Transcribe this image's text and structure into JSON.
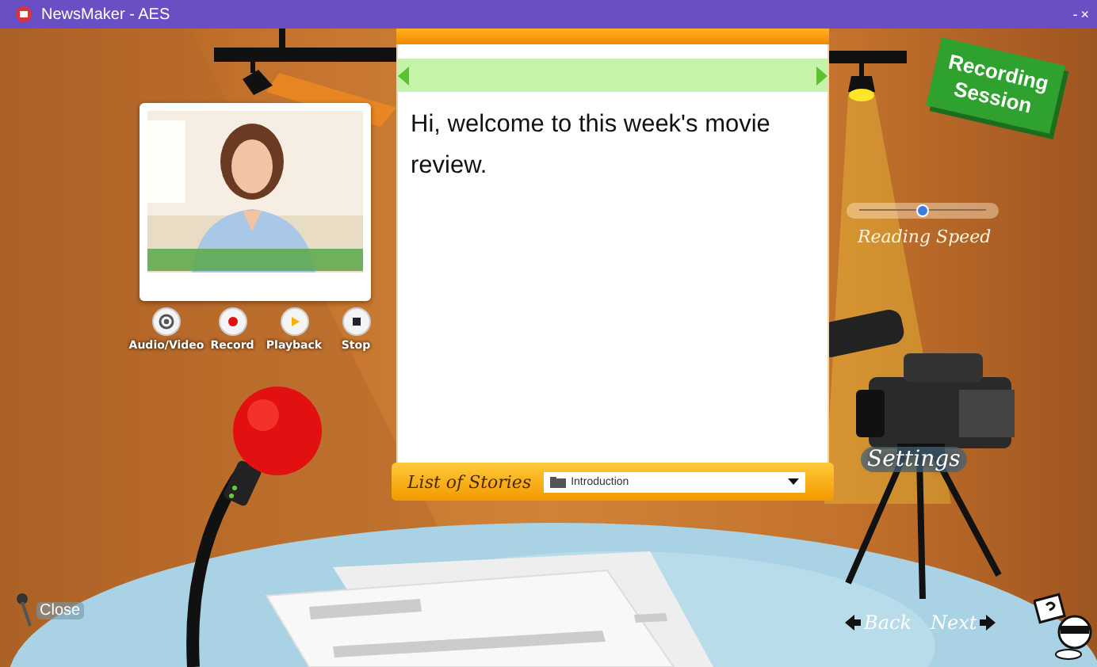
{
  "window": {
    "title": "NewsMaker - AES",
    "controls": [
      "-",
      "×"
    ]
  },
  "media_buttons": [
    {
      "label": "Audio/Video",
      "kind": "audiovideo"
    },
    {
      "label": "Record",
      "kind": "record"
    },
    {
      "label": "Playback",
      "kind": "play"
    },
    {
      "label": "Stop",
      "kind": "stop"
    }
  ],
  "script": {
    "text": "Hi, welcome to this week's movie review."
  },
  "session_sign": {
    "text": "Recording Session"
  },
  "reading_speed": {
    "label": "Reading Speed",
    "level": 0.5
  },
  "settings": {
    "label": "Settings"
  },
  "stories": {
    "label": "List of Stories",
    "value": "Introduction"
  },
  "navigation": {
    "close": "Close",
    "back": "Back",
    "next": "Next"
  }
}
